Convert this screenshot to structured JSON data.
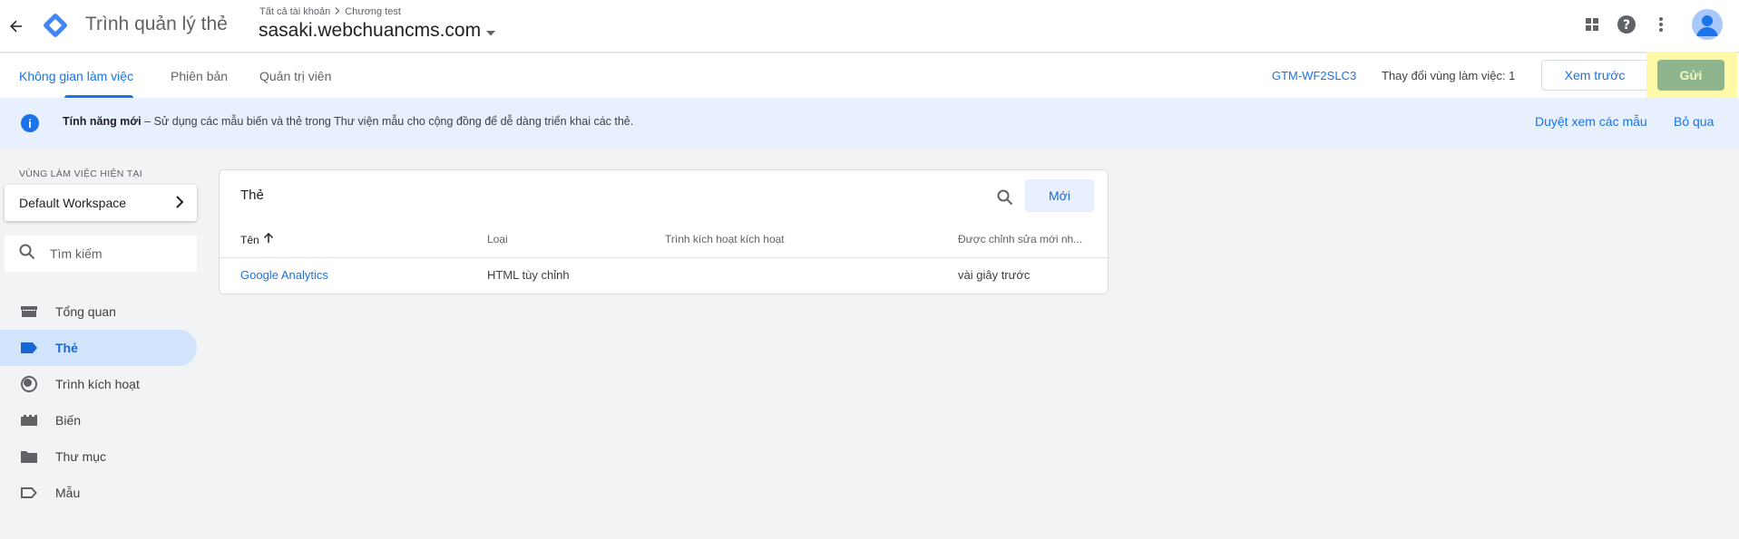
{
  "header": {
    "app_title": "Trình quản lý thẻ",
    "breadcrumb": {
      "account": "Tất cả tài khoản",
      "container": "Chương test"
    },
    "container_name": "sasaki.webchuancms.com"
  },
  "nav": {
    "tabs": [
      {
        "label": "Không gian làm việc"
      },
      {
        "label": "Phiên bản"
      },
      {
        "label": "Quản trị viên"
      }
    ],
    "gtm_id": "GTM-WF2SLC3",
    "workspace_changes": "Thay đổi vùng làm việc: 1",
    "preview_label": "Xem trước",
    "submit_label": "Gửi"
  },
  "banner": {
    "bold": "Tính năng mới",
    "text": " – Sử dụng các mẫu biến và thẻ trong Thư viện mẫu cho cộng đồng để dễ dàng triển khai các thẻ.",
    "browse_label": "Duyệt xem các mẫu",
    "dismiss_label": "Bỏ qua"
  },
  "sidebar": {
    "workspace_label": "VÙNG LÀM VIỆC HIỆN TẠI",
    "workspace_name": "Default Workspace",
    "search_placeholder": "Tìm kiếm",
    "items": [
      {
        "label": "Tổng quan",
        "icon": "overview-icon"
      },
      {
        "label": "Thẻ",
        "icon": "tag-icon"
      },
      {
        "label": "Trình kích hoạt",
        "icon": "trigger-icon"
      },
      {
        "label": "Biến",
        "icon": "variable-icon"
      },
      {
        "label": "Thư mục",
        "icon": "folder-icon"
      },
      {
        "label": "Mẫu",
        "icon": "template-icon"
      }
    ]
  },
  "tags_table": {
    "title": "Thẻ",
    "new_label": "Mới",
    "columns": [
      "Tên",
      "Loại",
      "Trình kích hoạt kích hoạt",
      "Được chỉnh sửa mới nh..."
    ],
    "rows": [
      {
        "name": "Google Analytics",
        "type": "HTML tùy chỉnh",
        "triggers": "",
        "edited": "vài giây trước"
      }
    ]
  },
  "colors": {
    "accent": "#1a73e8",
    "submit_bg": "#8fb58f",
    "highlight": "#fff9a8",
    "banner_bg": "#e8f0fe"
  }
}
